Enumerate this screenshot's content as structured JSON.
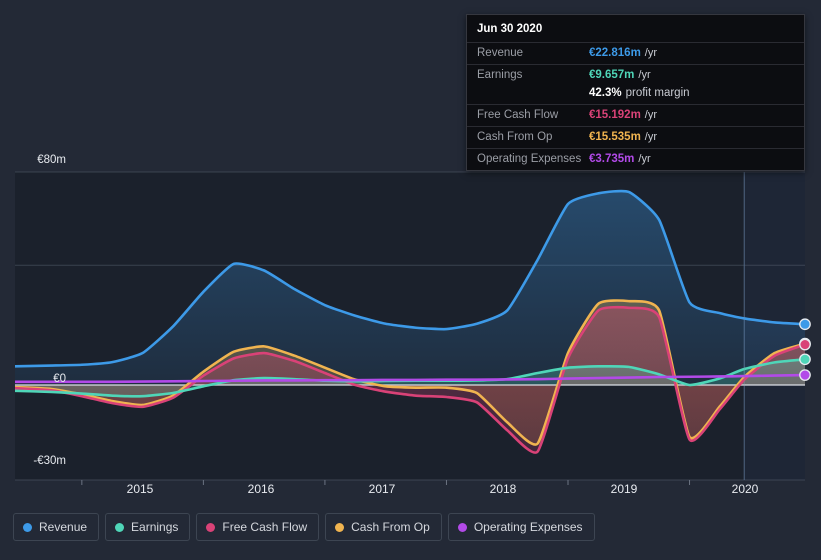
{
  "tooltip": {
    "title": "Jun 30 2020",
    "rows": [
      {
        "name": "Revenue",
        "value": "€22.816m",
        "unit": "/yr",
        "color": "#3d9ae8"
      },
      {
        "name": "Earnings",
        "value": "€9.657m",
        "unit": "/yr",
        "color": "#4fd6b8"
      },
      {
        "name": "Free Cash Flow",
        "value": "€15.192m",
        "unit": "/yr",
        "color": "#e0417e"
      },
      {
        "name": "Cash From Op",
        "value": "€15.535m",
        "unit": "/yr",
        "color": "#f0b450"
      },
      {
        "name": "Operating Expenses",
        "value": "€3.735m",
        "unit": "/yr",
        "color": "#b martial"
      }
    ],
    "profit_margin": {
      "value": "42.3%",
      "label": "profit margin"
    }
  },
  "legend": [
    {
      "label": "Revenue",
      "color": "#3d9ae8"
    },
    {
      "label": "Earnings",
      "color": "#4fd6b8"
    },
    {
      "label": "Free Cash Flow",
      "color": "#d94277"
    },
    {
      "label": "Cash From Op",
      "color": "#f0b450"
    },
    {
      "label": "Operating Expenses",
      "color": "#b24ae8"
    }
  ],
  "axis": {
    "y_labels": [
      "€80m",
      "€0",
      "-€30m"
    ],
    "x_labels": [
      "2015",
      "2016",
      "2017",
      "2018",
      "2019",
      "2020"
    ]
  },
  "chart_data": {
    "type": "area",
    "title": "",
    "xlabel": "",
    "ylabel": "",
    "ylim": [
      -30,
      80
    ],
    "xlim": [
      2014.45,
      2020.95
    ],
    "grid": true,
    "gridlines_y": [
      80,
      45,
      0,
      -30
    ],
    "legend_position": "bottom",
    "currency": "EUR",
    "units": "millions",
    "forecast_boundary": 2020.45,
    "x": [
      2014.45,
      2014.75,
      2015.0,
      2015.25,
      2015.5,
      2015.75,
      2016.0,
      2016.25,
      2016.5,
      2016.75,
      2017.0,
      2017.25,
      2017.5,
      2017.75,
      2018.0,
      2018.25,
      2018.5,
      2018.75,
      2019.0,
      2019.25,
      2019.5,
      2019.75,
      2020.0,
      2020.25,
      2020.45,
      2020.7,
      2020.95
    ],
    "series": [
      {
        "name": "Revenue",
        "color": "#3d9ae8",
        "fill": true,
        "values": [
          7.0,
          7.3,
          7.6,
          8.6,
          12.0,
          22.0,
          35.0,
          45.5,
          43.0,
          36.0,
          30.0,
          26.0,
          23.0,
          21.5,
          21.0,
          23.0,
          28.0,
          47.0,
          68.0,
          72.0,
          72.5,
          62.0,
          31.0,
          27.0,
          25.0,
          23.5,
          22.816
        ],
        "endpoint_value": 22.816
      },
      {
        "name": "Cash From Op",
        "color": "#f0b450",
        "fill": true,
        "values": [
          -0.8,
          -1.5,
          -3.5,
          -6.0,
          -7.5,
          -4.0,
          5.0,
          12.5,
          14.5,
          11.0,
          6.5,
          2.0,
          -0.5,
          -1.0,
          -1.0,
          -3.0,
          -14.0,
          -22.0,
          12.0,
          30.5,
          31.5,
          28.0,
          -19.5,
          -8.0,
          3.0,
          12.0,
          15.535
        ],
        "endpoint_value": 15.535
      },
      {
        "name": "Free Cash Flow",
        "color": "#d94277",
        "fill": true,
        "values": [
          -1.2,
          -2.0,
          -4.2,
          -6.8,
          -8.2,
          -4.8,
          3.5,
          10.0,
          12.0,
          9.0,
          4.5,
          0.0,
          -2.5,
          -4.0,
          -4.5,
          -6.5,
          -17.0,
          -25.0,
          10.0,
          28.0,
          29.0,
          25.5,
          -20.5,
          -9.0,
          2.0,
          11.0,
          15.192
        ],
        "endpoint_value": 15.192
      },
      {
        "name": "Earnings",
        "color": "#4fd6b8",
        "fill": true,
        "values": [
          -2.2,
          -2.6,
          -3.2,
          -4.0,
          -4.2,
          -3.0,
          -0.5,
          1.8,
          2.6,
          2.2,
          1.6,
          1.4,
          1.5,
          1.6,
          1.6,
          1.7,
          2.2,
          4.5,
          6.5,
          7.0,
          6.8,
          4.0,
          0.0,
          2.5,
          6.0,
          8.5,
          9.657
        ],
        "endpoint_value": 9.657
      },
      {
        "name": "Operating Expenses",
        "color": "#b24ae8",
        "fill": false,
        "values": [
          1.2,
          1.2,
          1.2,
          1.2,
          1.3,
          1.4,
          1.5,
          1.6,
          1.7,
          1.7,
          1.8,
          1.8,
          1.9,
          1.9,
          2.0,
          2.0,
          2.1,
          2.2,
          2.4,
          2.6,
          2.8,
          3.0,
          3.1,
          3.2,
          3.35,
          3.55,
          3.735
        ],
        "endpoint_value": 3.735
      }
    ]
  }
}
